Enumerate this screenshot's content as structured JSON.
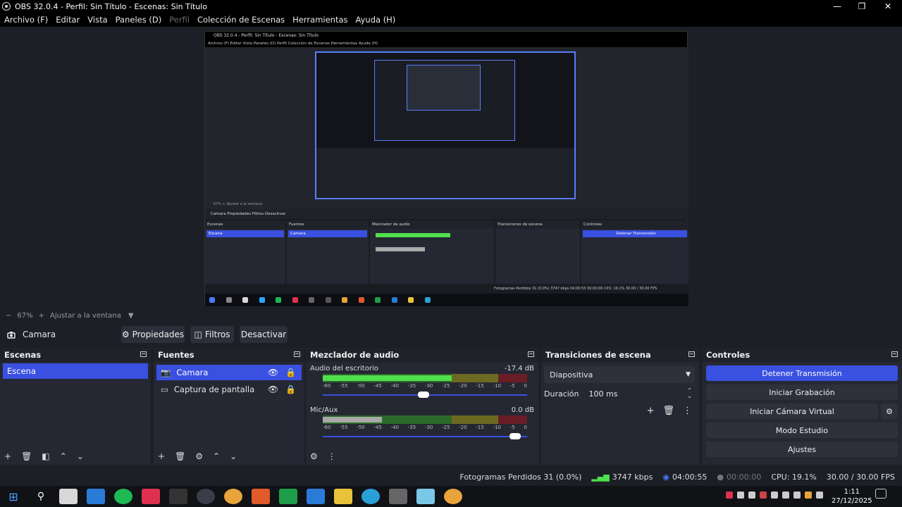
{
  "window": {
    "title": "OBS 32.0.4 - Perfil: Sin Título - Escenas: Sin Título",
    "minimize": "—",
    "maximize": "❐",
    "close": "✕"
  },
  "menu": [
    {
      "label": "Archivo (F)",
      "enabled": true
    },
    {
      "label": "Editar",
      "enabled": true
    },
    {
      "label": "Vista",
      "enabled": true
    },
    {
      "label": "Paneles (D)",
      "enabled": true
    },
    {
      "label": "Perfil",
      "enabled": false
    },
    {
      "label": "Colección de Escenas",
      "enabled": true
    },
    {
      "label": "Herramientas",
      "enabled": true
    },
    {
      "label": "Ayuda (H)",
      "enabled": true
    }
  ],
  "zoom": {
    "minus": "−",
    "level": "67%",
    "plus": "+",
    "fit": "Ajustar a la ventana"
  },
  "source_bar": {
    "selected": "Camara",
    "props": "Propiedades",
    "filters": "Filtros",
    "deactivate": "Desactivar"
  },
  "scenes": {
    "title": "Escenas",
    "items": [
      "Escena"
    ]
  },
  "sources": {
    "title": "Fuentes",
    "items": [
      "Camara",
      "Captura de pantalla"
    ]
  },
  "mixer": {
    "title": "Mezclador de audio",
    "channels": [
      {
        "name": "Audio del escritorio",
        "db": "-17.4 dB",
        "level": 0.63,
        "volume": 0.52,
        "color": "#4fe04c"
      },
      {
        "name": "Mic/Aux",
        "db": "0.0 dB",
        "level": 0.29,
        "volume": 0.97,
        "color": "#a9a9a9"
      }
    ],
    "ticks": [
      "-60",
      "-55",
      "-50",
      "-45",
      "-40",
      "-35",
      "-30",
      "-25",
      "-20",
      "-15",
      "-10",
      "-5",
      "0"
    ]
  },
  "transitions": {
    "title": "Transiciones de escena",
    "selected": "Diapositiva",
    "duration_label": "Duración",
    "duration": "100 ms"
  },
  "controls": {
    "title": "Controles",
    "buttons": [
      "Detener Transmisión",
      "Iniciar Grabación",
      "Iniciar Cámara Virtual",
      "Modo Estudio",
      "Ajustes"
    ]
  },
  "status": {
    "dropped": "Fotogramas Perdidos 31 (0.0%)",
    "bitrate": "3747 kbps",
    "stream_time": "04:00:55",
    "rec_time": "00:00:00",
    "cpu": "CPU: 19.1%",
    "fps": "30.00 / 30.00 FPS"
  },
  "taskbar": {
    "time": "1:11",
    "date": "27/12/2025"
  },
  "nested": {
    "title": "OBS 32.0.4 - Perfil: Sin Título - Escenas: Sin Título",
    "menu": "Archivo (F)   Editar   Vista   Paneles (D)   Perfil   Colección de Escenas   Herramientas   Ayuda (H)",
    "zoom": "67%   +   Ajustar a la ventana",
    "src": "Camara      Propiedades   Filtros   Desactivar",
    "status": "Fotogramas Perdidos 31 (0.0%)   3747 kbps   04:00:55   00:00:00   CPU: 19.1%   30.00 / 30.00 FPS"
  },
  "colors": {
    "accent": "#3a50e0",
    "panel": "#252833",
    "bg": "#1d1f26"
  }
}
